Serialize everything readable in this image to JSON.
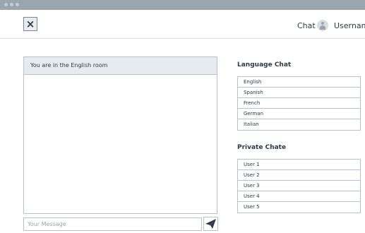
{
  "header": {
    "close_symbol": "×",
    "nav_chat": "Chat",
    "username": "Username"
  },
  "chat": {
    "room_banner": "You are in the English room",
    "input_placeholder": "Your Message"
  },
  "sidebar": {
    "language_title": "Language Chat",
    "languages": [
      "English",
      "Spanish",
      "French",
      "German",
      "Italian"
    ],
    "private_title": "Private Chate",
    "users": [
      "User 1",
      "User 2",
      "User 3",
      "User 4",
      "User 5"
    ]
  },
  "icons": {
    "close": "close-icon",
    "avatar": "user-avatar-icon",
    "send": "paper-plane-icon"
  },
  "colors": {
    "titlebar": "#9ba5ae",
    "banner_bg": "#e6ebf0",
    "border": "#b9c2ca",
    "text": "#2e3946"
  }
}
